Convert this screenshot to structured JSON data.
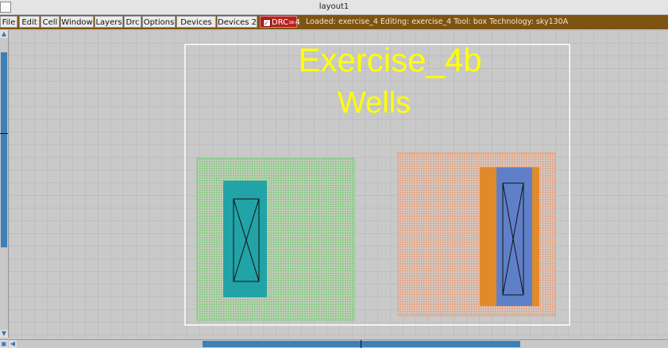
{
  "window": {
    "title": "layout1"
  },
  "menu": [
    {
      "name": "menu-file",
      "label": "File"
    },
    {
      "name": "menu-edit",
      "label": "Edit"
    },
    {
      "name": "menu-cell",
      "label": "Cell"
    },
    {
      "name": "menu-window",
      "label": "Window"
    },
    {
      "name": "menu-layers",
      "label": "Layers"
    },
    {
      "name": "menu-drc",
      "label": "Drc"
    },
    {
      "name": "menu-options",
      "label": "Options"
    },
    {
      "name": "menu-devices1",
      "label": "Devices 1"
    },
    {
      "name": "menu-devices2",
      "label": "Devices 2"
    }
  ],
  "drc": {
    "label": "DRC=4",
    "checked": true
  },
  "status": "Loaded: exercise_4 Editing: exercise_4 Tool: box  Technology: sky130A",
  "layout": {
    "title_line1": "Exercise_4b",
    "title_line2": "Wells"
  },
  "colors": {
    "menubar": "#7e5414",
    "drc": "#b8231d",
    "label": "#ffff00",
    "nwell_fill": "#66cc66",
    "diff": "#22a3a8",
    "pwell_fill": "#e8946a",
    "ndiff": "#e08a2c",
    "poly": "#5f80c8",
    "scroll": "#3d7fb8"
  }
}
